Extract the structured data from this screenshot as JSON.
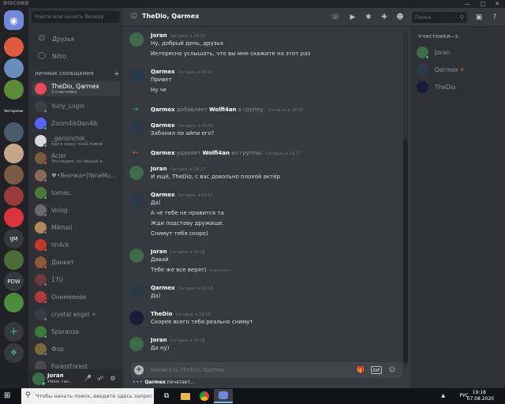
{
  "window": {
    "brand": "DISCORD",
    "minimize_icon": "minimize-icon",
    "maximize_icon": "maximize-icon",
    "close_icon": "close-icon"
  },
  "servers": [
    {
      "label": "",
      "color": "#7289da",
      "icon": "home-icon"
    },
    {
      "label": "",
      "color": "#e05a3f"
    },
    {
      "label": "",
      "color": "#6a8dbd"
    },
    {
      "label": "",
      "color": "#5a8c3c"
    },
    {
      "label": "Эйнтернешн",
      "color": "#202225"
    },
    {
      "label": "",
      "color": "#4b5a6b"
    },
    {
      "label": "",
      "color": "#c4a68a"
    },
    {
      "label": "",
      "color": "#7c5a42"
    },
    {
      "label": "",
      "color": "#9c3b3b"
    },
    {
      "label": "",
      "color": "#d9343b"
    },
    {
      "label": "IJM",
      "color": "#36393f"
    },
    {
      "label": "",
      "color": "#4b6b3a"
    },
    {
      "label": "PDW",
      "color": "#36393f"
    },
    {
      "label": "",
      "color": "#4b8b3a"
    },
    {
      "label": "+",
      "color": "#36393f",
      "icon": "add-server-icon"
    },
    {
      "label": "",
      "color": "#36393f",
      "icon": "explore-icon"
    }
  ],
  "dm_search": {
    "placeholder": "Найти или начать беседу"
  },
  "nav": [
    {
      "label": "Друзья",
      "icon": "friends-icon"
    },
    {
      "label": "Nitro",
      "icon": "nitro-icon"
    }
  ],
  "dm_section": {
    "title": "ЛИЧНЫЕ СООБЩЕНИЯ",
    "add_label": "+"
  },
  "dms": [
    {
      "name": "TheDio, Qarmex",
      "sub": "3 участника",
      "color": "#e74c5e",
      "status": "",
      "active": true
    },
    {
      "name": "Yuriy_Login",
      "sub": "",
      "color": "#3b3e45",
      "status": "#747f8d"
    },
    {
      "name": "Zoom4ikDan4ik",
      "sub": "",
      "color": "#5865f2",
      "status": "#43b581"
    },
    {
      "name": "_geroinchik_",
      "sub": "иди в сраку пожа живой",
      "color": "#d9d9d9",
      "status": "#43b581"
    },
    {
      "name": "Acler",
      "sub": "Это модем, ты чёрный и...",
      "color": "#7a5c3c",
      "status": "#f04747"
    },
    {
      "name": "♥•Яночка•|YanaMu...",
      "sub": "",
      "color": "#8a6b5a",
      "status": "#747f8d"
    },
    {
      "name": "tomas.",
      "sub": "",
      "color": "#4b7a3a",
      "status": "#43b581"
    },
    {
      "name": "Volog",
      "sub": "",
      "color": "#6a6a6a",
      "status": "#747f8d"
    },
    {
      "name": "Mikhail",
      "sub": "",
      "color": "#b08a5a",
      "status": "#747f8d"
    },
    {
      "name": "hh4ck",
      "sub": "",
      "color": "#c0392b",
      "status": "#f04747"
    },
    {
      "name": "Данкет",
      "sub": "",
      "color": "#8a5a3a",
      "status": "#f04747"
    },
    {
      "name": "17U",
      "sub": "",
      "color": "#6a3a3a",
      "status": "#747f8d"
    },
    {
      "name": "Онимеееее",
      "sub": "",
      "color": "#b03a3a",
      "status": "#f04747"
    },
    {
      "name": "crystal angel ✧",
      "sub": "",
      "color": "#3a3a4a",
      "status": "#747f8d"
    },
    {
      "name": "Sparanze",
      "sub": "",
      "color": "#3a7a3a",
      "status": "#43b581"
    },
    {
      "name": "Фор",
      "sub": "",
      "color": "#7a6a3a",
      "status": "#747f8d"
    },
    {
      "name": "ForestForest",
      "sub": "",
      "color": "#4a4a4a",
      "status": "#747f8d"
    }
  ],
  "user": {
    "name": "Joran",
    "status": "Умею тан...",
    "mic_icon": "microphone-icon",
    "headset_icon": "headphones-icon",
    "settings_icon": "gear-icon"
  },
  "chat_header": {
    "title": "TheDio, Qarmex",
    "search_placeholder": "Поиск",
    "icons": [
      "phone-call-icon",
      "video-call-icon",
      "pin-icon",
      "add-member-icon",
      "members-icon",
      "inbox-icon",
      "help-icon"
    ]
  },
  "messages": [
    {
      "type": "msg",
      "author": "Joran",
      "time": "Сегодня, в 19:16",
      "avatar": "#3e6b4a",
      "lines": [
        "Ну, добрый день, друзья",
        "Интересно услышать, что вы мне скажите на этот раз"
      ]
    },
    {
      "type": "msg",
      "author": "Qarmex",
      "time": "Сегодня, в 19:16",
      "avatar": "#2b3a4a",
      "lines": [
        "Привет",
        "Ну че"
      ]
    },
    {
      "type": "sys",
      "kind": "add",
      "actor": "Qarmex",
      "verb": "добавляет",
      "target": "Wolfi4an",
      "tail": "в группу.",
      "time": "Сегодня, в 19:16"
    },
    {
      "type": "msg",
      "author": "Qarmex",
      "time": "Сегодня, в 19:16",
      "avatar": "#2b3a4a",
      "lines": [
        "Забанил по айпи его?"
      ]
    },
    {
      "type": "sys",
      "kind": "remove",
      "actor": "Qarmex",
      "verb": "удаляет",
      "target": "Wolfi4an",
      "tail": "из группы.",
      "time": "Сегодня, в 19:17"
    },
    {
      "type": "msg",
      "author": "Joran",
      "time": "Сегодня, в 19:17",
      "avatar": "#3e6b4a",
      "lines": [
        "И ещё, TheDio, с вас довольно плохой актёр"
      ]
    },
    {
      "type": "msg",
      "author": "Qarmex",
      "time": "Сегодня, в 19:17",
      "avatar": "#2b3a4a",
      "lines": [
        "Да)",
        "А че тебе не нравится та",
        "Жди подставу дружище.",
        "Снимут тебя скоро)"
      ]
    },
    {
      "type": "msg",
      "author": "Joran",
      "time": "Сегодня, в 19:18",
      "avatar": "#3e6b4a",
      "lines": [
        "Давай",
        "Тебе же все верят)"
      ],
      "edited": "(изменено)"
    },
    {
      "type": "msg",
      "author": "Qarmex",
      "time": "Сегодня, в 19:18",
      "avatar": "#2b3a4a",
      "lines": [
        "Да)"
      ]
    },
    {
      "type": "msg",
      "author": "TheDio",
      "time": "Сегодня, в 19:18",
      "avatar": "#1a1a3a",
      "lines": [
        "Скорее всего тебя реально снимут"
      ]
    },
    {
      "type": "msg",
      "author": "Joran",
      "time": "Сегодня, в 19:18",
      "avatar": "#3e6b4a",
      "lines": [
        "Да ну)"
      ]
    }
  ],
  "composer": {
    "placeholder": "Написать TheDio, Qarmex",
    "gift_icon": "gift-icon",
    "gif_label": "GIF",
    "emoji_icon": "emoji-icon"
  },
  "typing": {
    "user": "Qarmex",
    "text": "печатает..."
  },
  "members": {
    "header": "УЧАСТНИКИ—3",
    "list": [
      {
        "name": "Joran",
        "color": "#3e6b4a",
        "status": "#43b581",
        "owner": false
      },
      {
        "name": "Qarmex",
        "color": "#2b3a4a",
        "status": "",
        "owner": true
      },
      {
        "name": "TheDio",
        "color": "#1a1a3a",
        "status": "",
        "owner": false
      }
    ]
  },
  "taskbar": {
    "search_placeholder": "Чтобы начать поиск, введите здесь запрос",
    "apps": [
      "task-view-icon",
      "file-explorer-icon",
      "chrome-icon",
      "discord-icon"
    ],
    "tray": {
      "lang": "РУС",
      "time": "19:18",
      "date": "07.08.2020",
      "arrow_icon": "tray-arrow-icon"
    }
  },
  "colors": {
    "accent": "#7289da",
    "online": "#43b581",
    "dnd": "#f04747",
    "idle": "#faa61a",
    "add_arrow": "#43b581",
    "remove_arrow": "#f04747"
  }
}
